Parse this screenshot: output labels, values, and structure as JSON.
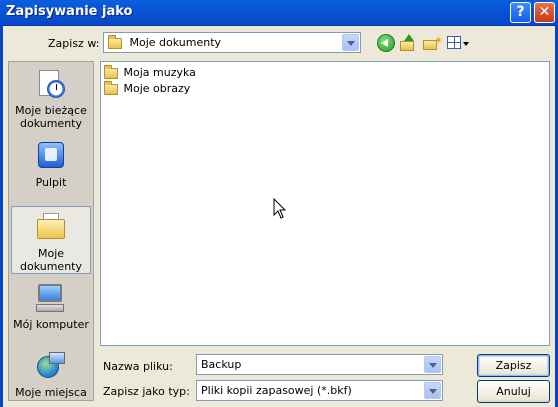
{
  "window": {
    "title": "Zapisywanie jako",
    "help_label": "?",
    "close_label": "✕"
  },
  "toolbar": {
    "save_in_label": "Zapisz w:",
    "save_in_value": "Moje dokumenty",
    "icons": [
      "back-icon",
      "up-folder-icon",
      "new-folder-icon",
      "views-menu-icon"
    ]
  },
  "places": [
    {
      "label": "Moje bieżące dokumenty",
      "icon": "recent-documents-icon"
    },
    {
      "label": "Pulpit",
      "icon": "desktop-icon"
    },
    {
      "label": "Moje dokumenty",
      "icon": "my-documents-icon"
    },
    {
      "label": "Mój komputer",
      "icon": "my-computer-icon"
    },
    {
      "label": "Moje miejsca",
      "icon": "network-places-icon"
    }
  ],
  "files": [
    {
      "name": "Moja muzyka",
      "icon": "folder-icon"
    },
    {
      "name": "Moje obrazy",
      "icon": "folder-icon"
    }
  ],
  "form": {
    "filename_label": "Nazwa pliku:",
    "filename_value": "Backup",
    "filetype_label": "Zapisz jako typ:",
    "filetype_value": "Pliki kopii zapasowej (*.bkf)"
  },
  "buttons": {
    "save": "Zapisz",
    "cancel": "Anuluj"
  },
  "colors": {
    "titlebar": "#0a53d6",
    "dialog_bg": "#ece9d8",
    "field_border": "#7f9db9"
  }
}
